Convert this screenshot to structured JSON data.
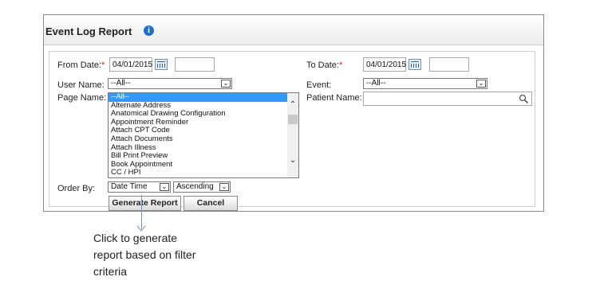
{
  "header": {
    "title": "Event Log Report",
    "info_icon": "info-icon"
  },
  "form": {
    "from_date": {
      "label": "From Date:",
      "required_mark": "*",
      "value": "04/01/2015",
      "time_value": ""
    },
    "to_date": {
      "label": "To Date:",
      "required_mark": "*",
      "value": "04/01/2015",
      "time_value": ""
    },
    "user_name": {
      "label": "User Name:",
      "selected": "--All--"
    },
    "event": {
      "label": "Event:",
      "selected": "--All--"
    },
    "page_name": {
      "label": "Page Name:",
      "options": [
        "--All--",
        "Alternate Address",
        "Anatomical Drawing Configuration",
        "Appointment Reminder",
        "Attach CPT Code",
        "Attach Documents",
        "Attach Illness",
        "Bill Print Preview",
        "Book Appointment",
        "CC / HPI"
      ],
      "selected_index": 0
    },
    "patient_name": {
      "label": "Patient Name:",
      "value": ""
    },
    "order_by": {
      "label": "Order By:",
      "field": "Date Time",
      "direction": "Ascending"
    }
  },
  "buttons": {
    "generate": "Generate Report",
    "cancel": "Cancel"
  },
  "callout": {
    "text": "Click to generate report based on filter criteria"
  },
  "colors": {
    "selection": "#3399ff",
    "info": "#1e6fd0",
    "required": "#dd2211"
  }
}
